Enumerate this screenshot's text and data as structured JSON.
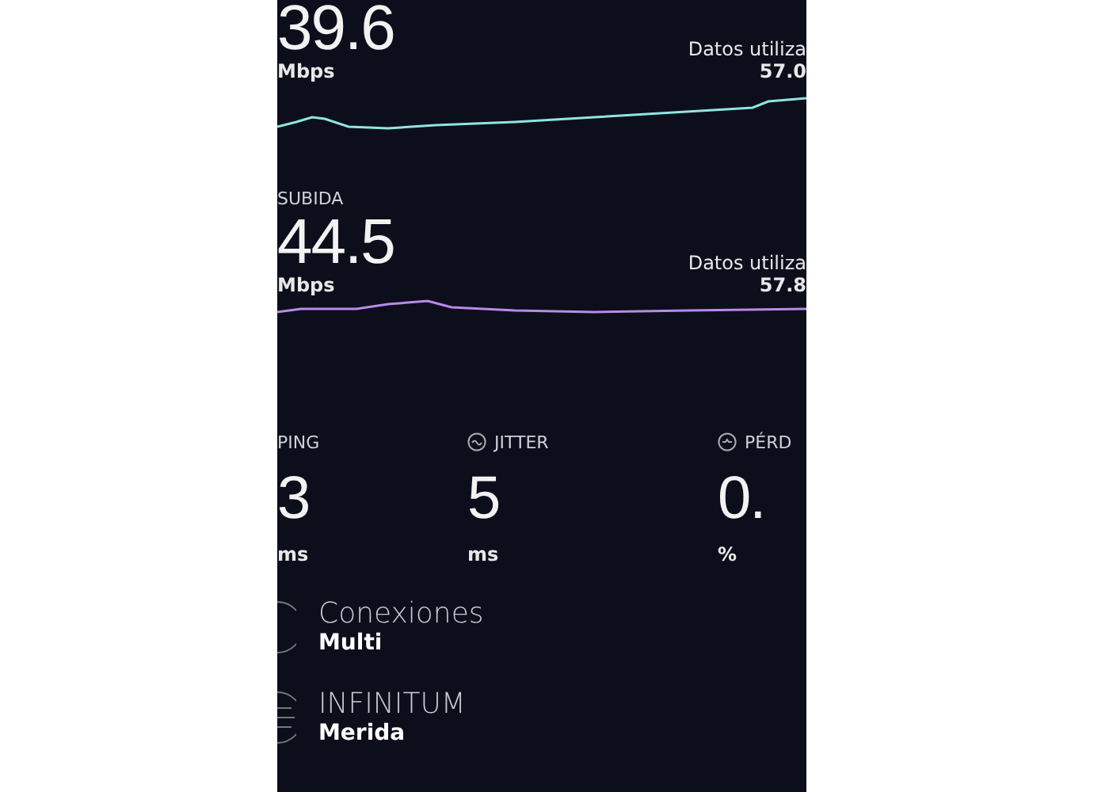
{
  "download": {
    "value": "39.6",
    "unit": "Mbps",
    "data_label": "Datos utiliza",
    "data_value": "57.0"
  },
  "upload": {
    "label": "SUBIDA",
    "value": "44.5",
    "unit": "Mbps",
    "data_label": "Datos utiliza",
    "data_value": "57.8"
  },
  "metrics": [
    {
      "kind": "ping",
      "label": "PING",
      "value": "3",
      "unit": "ms"
    },
    {
      "kind": "jitter",
      "label": "JITTER",
      "value": "5",
      "unit": "ms"
    },
    {
      "kind": "loss",
      "label": "PÉRD",
      "value": "0.",
      "unit": "%"
    }
  ],
  "connections": [
    {
      "kind": "connections",
      "title": "Conexiones",
      "value": "Multi"
    },
    {
      "kind": "provider",
      "title": "INFINITUM",
      "value": "Merida"
    }
  ]
}
